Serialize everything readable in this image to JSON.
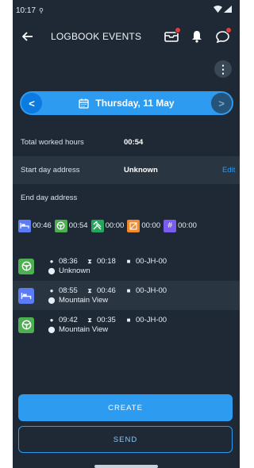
{
  "status_bar": {
    "time": "10:17"
  },
  "app_bar": {
    "title": "LOGBOOK EVENTS"
  },
  "date_nav": {
    "date": "Thursday, 11 May"
  },
  "summary": {
    "worked_label": "Total worked hours",
    "worked_value": "00:54",
    "start_label": "Start day address",
    "start_value": "Unknown",
    "edit_label": "Edit",
    "end_label": "End day address"
  },
  "legend": [
    {
      "icon": "bed-icon",
      "value": "00:46",
      "color": "#5b7cf5"
    },
    {
      "icon": "steering-wheel-icon",
      "value": "00:54",
      "color": "#4caf50"
    },
    {
      "icon": "hammer-icon",
      "value": "00:00",
      "color": "#26a65b"
    },
    {
      "icon": "pause-icon",
      "value": "00:00",
      "color": "#f28a2c"
    },
    {
      "icon": "hash-icon",
      "value": "00:00",
      "color": "#7a5cf0"
    }
  ],
  "events": [
    {
      "type": "steering-wheel-icon",
      "color": "#4caf50",
      "time": "08:36",
      "duration": "00:18",
      "plate": "00-JH-00",
      "location": "Unknown"
    },
    {
      "type": "bed-icon",
      "color": "#5b7cf5",
      "time": "08:55",
      "duration": "00:46",
      "plate": "00-JH-00",
      "location": "Mountain View"
    },
    {
      "type": "steering-wheel-icon",
      "color": "#4caf50",
      "time": "09:42",
      "duration": "00:35",
      "plate": "00-JH-00",
      "location": "Mountain View"
    }
  ],
  "actions": {
    "create": "CREATE",
    "send": "SEND"
  },
  "colors": {
    "accent": "#2d9bf0",
    "background": "#1f2935",
    "badge": "#e83a3a"
  }
}
